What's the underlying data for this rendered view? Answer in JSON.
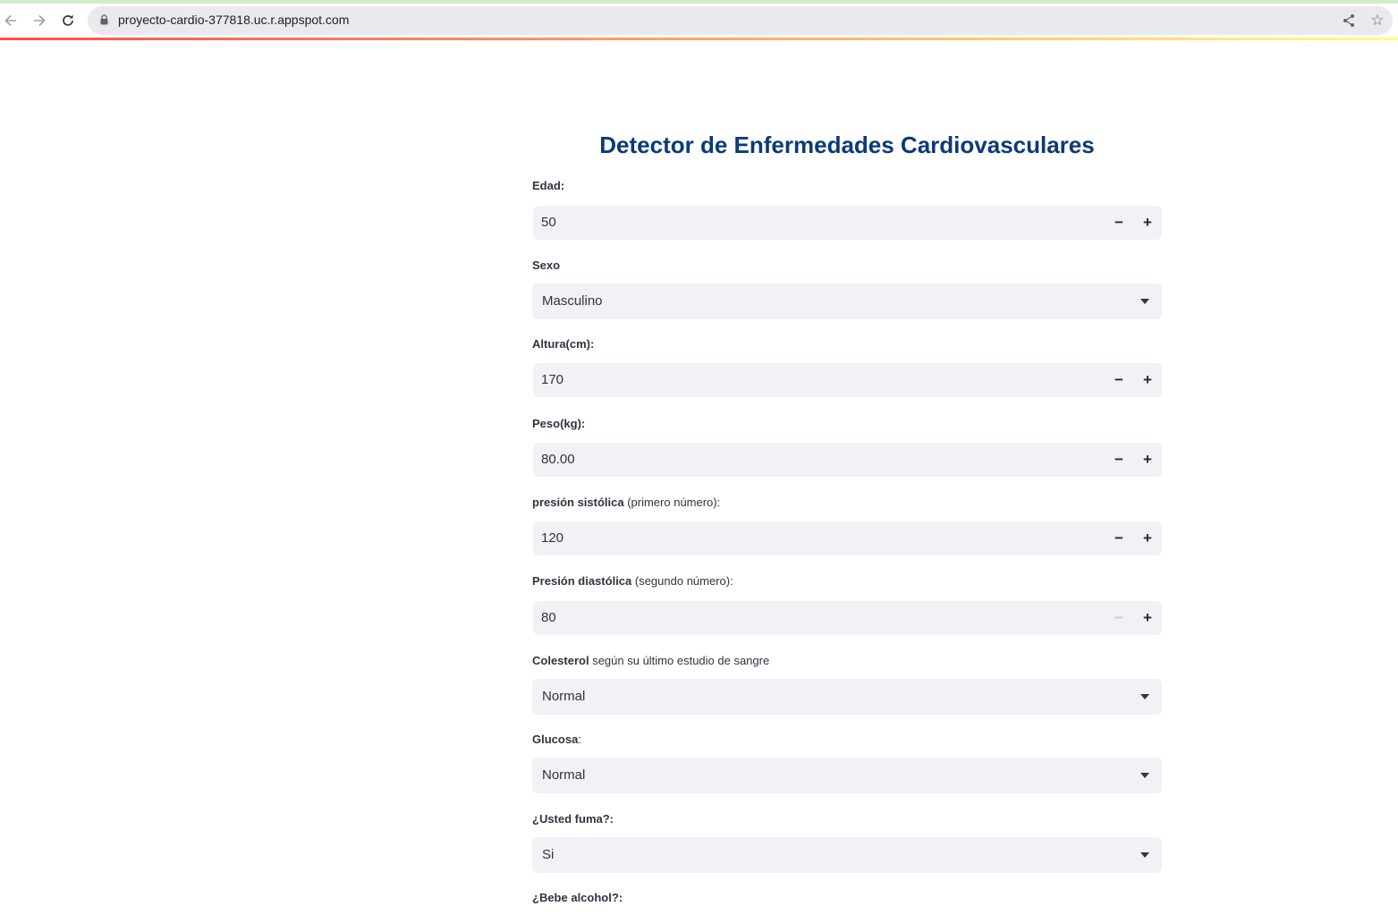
{
  "browser": {
    "url": "proyecto-cardio-377818.uc.r.appspot.com",
    "icons": [
      "back-arrow-icon",
      "forward-arrow-icon",
      "reload-icon",
      "lock-icon",
      "share-icon",
      "star-icon"
    ]
  },
  "page": {
    "title": "Detector de Enfermedades Cardiovasculares"
  },
  "form": {
    "edad": {
      "label": "Edad:",
      "value": "50"
    },
    "sexo": {
      "label": "Sexo",
      "value": "Masculino"
    },
    "altura": {
      "label": "Altura(cm):",
      "value": "170"
    },
    "peso": {
      "label": "Peso(kg):",
      "value": "80.00"
    },
    "sistolica": {
      "label_bold": "presión sistólica",
      "label_rest": " (primero número):",
      "value": "120"
    },
    "diastolica": {
      "label_bold": "Presión diastólica",
      "label_rest": " (segundo número):",
      "value": "80"
    },
    "colesterol": {
      "label_bold": "Colesterol",
      "label_rest": " según su último estudio de sangre",
      "value": "Normal"
    },
    "glucosa": {
      "label_bold": "Glucosa",
      "label_rest": ":",
      "value": "Normal"
    },
    "fuma": {
      "label": "¿Usted fuma?:",
      "value": "Si"
    },
    "alcohol": {
      "label": "¿Bebe alcohol?:"
    }
  },
  "colors": {
    "title": "#0b3a7a",
    "input_bg": "#f0f2f6",
    "text": "#31333f",
    "decoration_start": "#ff4b4b",
    "decoration_end": "#fffd80"
  }
}
